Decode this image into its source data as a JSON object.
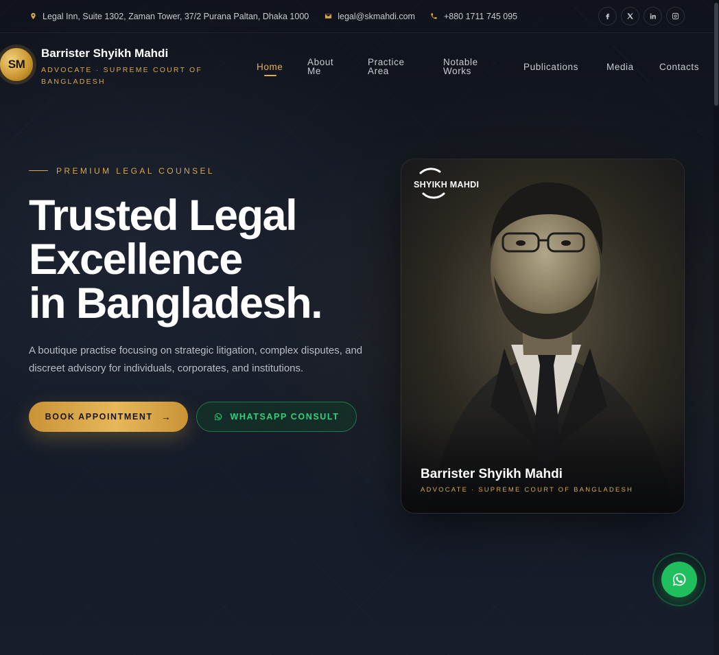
{
  "topbar": {
    "address": "Legal Inn, Suite 1302, Zaman Tower, 37/2 Purana Paltan, Dhaka 1000",
    "email": "legal@skmahdi.com",
    "phone": "+880 1711 745 095",
    "address_icon": "map-pin-icon",
    "email_icon": "envelope-icon",
    "phone_icon": "phone-icon",
    "socials": [
      "facebook-icon",
      "x-icon",
      "linkedin-icon",
      "instagram-icon"
    ]
  },
  "brand": {
    "badge": "SM",
    "name": "Barrister Shyikh Mahdi",
    "subtitle": "ADVOCATE · SUPREME COURT OF BANGLADESH"
  },
  "nav": {
    "items": [
      "Home",
      "About Me",
      "Practice Area",
      "Notable Works",
      "Publications",
      "Media",
      "Contacts"
    ],
    "active": "Home"
  },
  "hero": {
    "eyebrow": "PREMIUM LEGAL COUNSEL",
    "headline_line1": "Trusted Legal",
    "headline_line2": "Excellence",
    "headline_line3": "in Bangladesh.",
    "description": "A boutique practise focusing on strategic litigation, complex disputes, and discreet advisory for individuals, corporates, and institutions.",
    "book_label": "BOOK APPOINTMENT",
    "whatsapp_label": "WHATSAPP CONSULT"
  },
  "card": {
    "logo_text": "SHYIKH MAHDI",
    "name": "Barrister Shyikh Mahdi",
    "title": "ADVOCATE · SUPREME COURT OF BANGLADESH"
  },
  "colors": {
    "accent_gold": "#d8a84a",
    "whatsapp_green": "#1fbf5e",
    "background": "#141a26"
  }
}
